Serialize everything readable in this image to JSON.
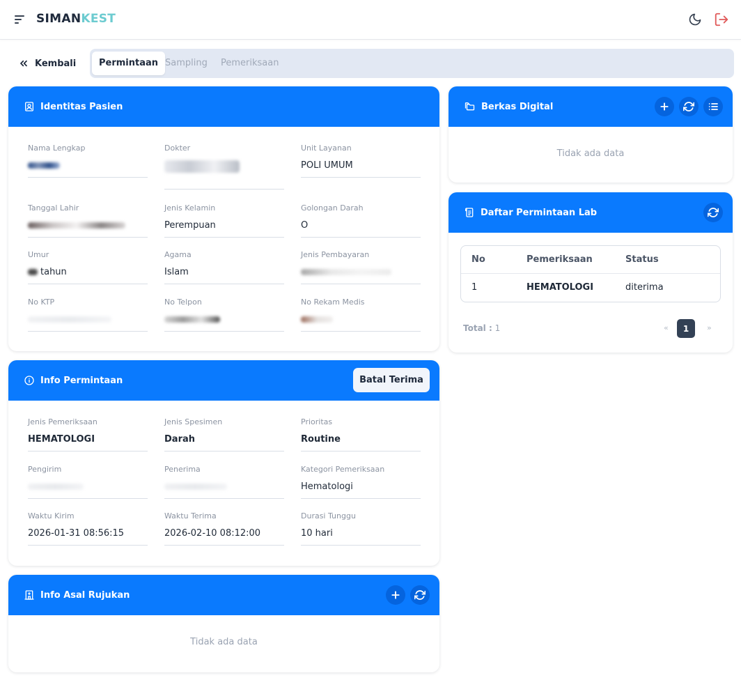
{
  "app": {
    "brand_part1": "SIMAN",
    "brand_part2": "KEST"
  },
  "nav": {
    "back_label": "Kembali",
    "tabs": [
      "Permintaan",
      "Sampling",
      "Pemeriksaan"
    ],
    "active_tab": "Permintaan"
  },
  "identitas": {
    "title": "Identitas Pasien",
    "fields": {
      "nama_lengkap": {
        "label": "Nama Lengkap",
        "value": ""
      },
      "dokter": {
        "label": "Dokter",
        "value": ""
      },
      "unit_layanan": {
        "label": "Unit Layanan",
        "value": "POLI UMUM"
      },
      "tanggal_lahir": {
        "label": "Tanggal Lahir",
        "value": ""
      },
      "jenis_kelamin": {
        "label": "Jenis Kelamin",
        "value": "Perempuan"
      },
      "golongan_darah": {
        "label": "Golongan Darah",
        "value": "O"
      },
      "umur": {
        "label": "Umur",
        "value": "tahun"
      },
      "agama": {
        "label": "Agama",
        "value": "Islam"
      },
      "jenis_pembayaran": {
        "label": "Jenis Pembayaran",
        "value": ""
      },
      "no_ktp": {
        "label": "No KTP",
        "value": ""
      },
      "no_telpon": {
        "label": "No Telpon",
        "value": ""
      },
      "no_rekam_medis": {
        "label": "No Rekam Medis",
        "value": ""
      }
    }
  },
  "info_permintaan": {
    "title": "Info Permintaan",
    "batal_label": "Batal Terima",
    "fields": {
      "jenis_pemeriksaan": {
        "label": "Jenis Pemeriksaan",
        "value": "HEMATOLOGI"
      },
      "jenis_spesimen": {
        "label": "Jenis Spesimen",
        "value": "Darah"
      },
      "prioritas": {
        "label": "Prioritas",
        "value": "Routine"
      },
      "pengirim": {
        "label": "Pengirim",
        "value": ""
      },
      "penerima": {
        "label": "Penerima",
        "value": ""
      },
      "kategori_pemeriksaan": {
        "label": "Kategori Pemeriksaan",
        "value": "Hematologi"
      },
      "waktu_kirim": {
        "label": "Waktu Kirim",
        "value": "2026-01-31 08:56:15"
      },
      "waktu_terima": {
        "label": "Waktu Terima",
        "value": "2026-02-10 08:12:00"
      },
      "durasi_tunggu": {
        "label": "Durasi Tunggu",
        "value": "10 hari"
      }
    }
  },
  "asal_rujukan": {
    "title": "Info Asal Rujukan",
    "empty": "Tidak ada data"
  },
  "berkas": {
    "title": "Berkas Digital",
    "empty": "Tidak ada data"
  },
  "lab": {
    "title": "Daftar Permintaan Lab",
    "headers": [
      "No",
      "Pemeriksaan",
      "Status"
    ],
    "rows": [
      {
        "no": "1",
        "pemeriksaan": "HEMATOLOGI",
        "status": "diterima"
      }
    ],
    "total_label": "Total :",
    "total_value": "1",
    "page_prev": "«",
    "page_current": "1",
    "page_next": "»"
  },
  "icons": {
    "menu": "menu-icon",
    "moon": "moon-icon",
    "logout": "logout-icon",
    "back": "chevrons-left-icon",
    "patient": "id-badge-icon",
    "info": "info-circle-icon",
    "hospital": "hospital-icon",
    "folder": "folders-icon",
    "document": "document-list-icon",
    "plus": "plus-icon",
    "refresh": "refresh-icon",
    "list": "list-icon"
  },
  "colors": {
    "primary": "#0a7afe",
    "brand_dark": "#1e293b",
    "brand_accent": "#6ccbd0",
    "logout": "#e05a5a"
  }
}
